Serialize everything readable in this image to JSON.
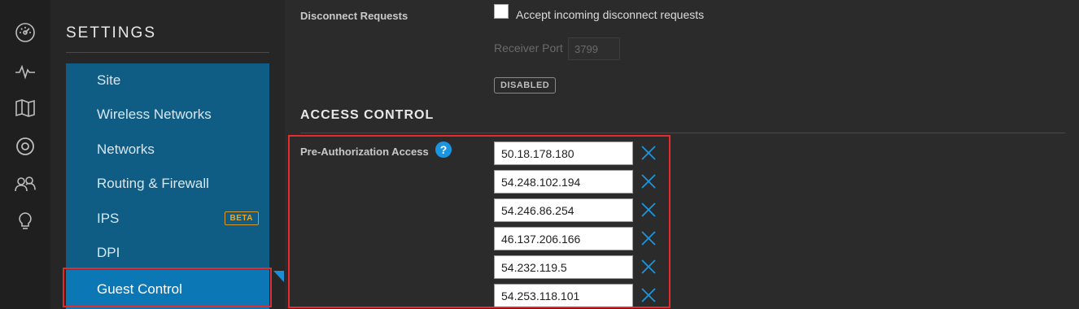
{
  "rail": {
    "icons": [
      "dashboard-icon",
      "statistics-icon",
      "map-icon",
      "devices-icon",
      "clients-icon",
      "insights-icon"
    ]
  },
  "settings": {
    "title": "SETTINGS",
    "nav": [
      {
        "label": "Site"
      },
      {
        "label": "Wireless Networks"
      },
      {
        "label": "Networks"
      },
      {
        "label": "Routing & Firewall"
      },
      {
        "label": "IPS",
        "badge": "BETA"
      },
      {
        "label": "DPI"
      },
      {
        "label": "Guest Control",
        "active": true
      }
    ]
  },
  "disconnect": {
    "label": "Disconnect Requests",
    "checkbox_label": "Accept incoming disconnect requests",
    "checked": false,
    "receiver_port_label": "Receiver Port",
    "receiver_port_placeholder": "3799",
    "status": "DISABLED"
  },
  "access_control": {
    "title": "ACCESS CONTROL",
    "pre_auth_label": "Pre-Authorization Access",
    "help": "?",
    "entries": [
      "50.18.178.180",
      "54.248.102.194",
      "54.246.86.254",
      "46.137.206.166",
      "54.232.119.5",
      "54.253.118.101"
    ]
  },
  "colors": {
    "accent": "#0b77b5",
    "nav_bg": "#0f5d85",
    "highlight": "#e52b2b",
    "remove": "#1a96e0",
    "beta": "#f0a623"
  }
}
